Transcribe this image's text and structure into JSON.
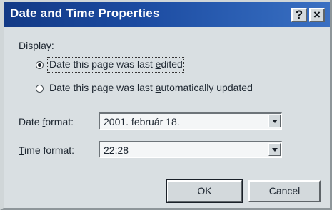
{
  "window": {
    "title": "Date and Time Properties",
    "help_label": "?",
    "close_label": "×"
  },
  "display": {
    "label": "Display:",
    "options": [
      {
        "pre": "Date this page was last ",
        "accel": "e",
        "post": "dited",
        "selected": true
      },
      {
        "pre": "Date this page was last ",
        "accel": "a",
        "post": "utomatically updated",
        "selected": false
      }
    ]
  },
  "date_format": {
    "label_pre": "Date ",
    "label_accel": "f",
    "label_post": "ormat:",
    "value": "2001. február 18."
  },
  "time_format": {
    "label_accel": "T",
    "label_post": "ime format:",
    "value": "22:28"
  },
  "buttons": {
    "ok_label": "OK",
    "cancel_label": "Cancel"
  },
  "colors": {
    "title_bar": "#1b4aa0",
    "dialog_bg": "#d9dfe2"
  }
}
